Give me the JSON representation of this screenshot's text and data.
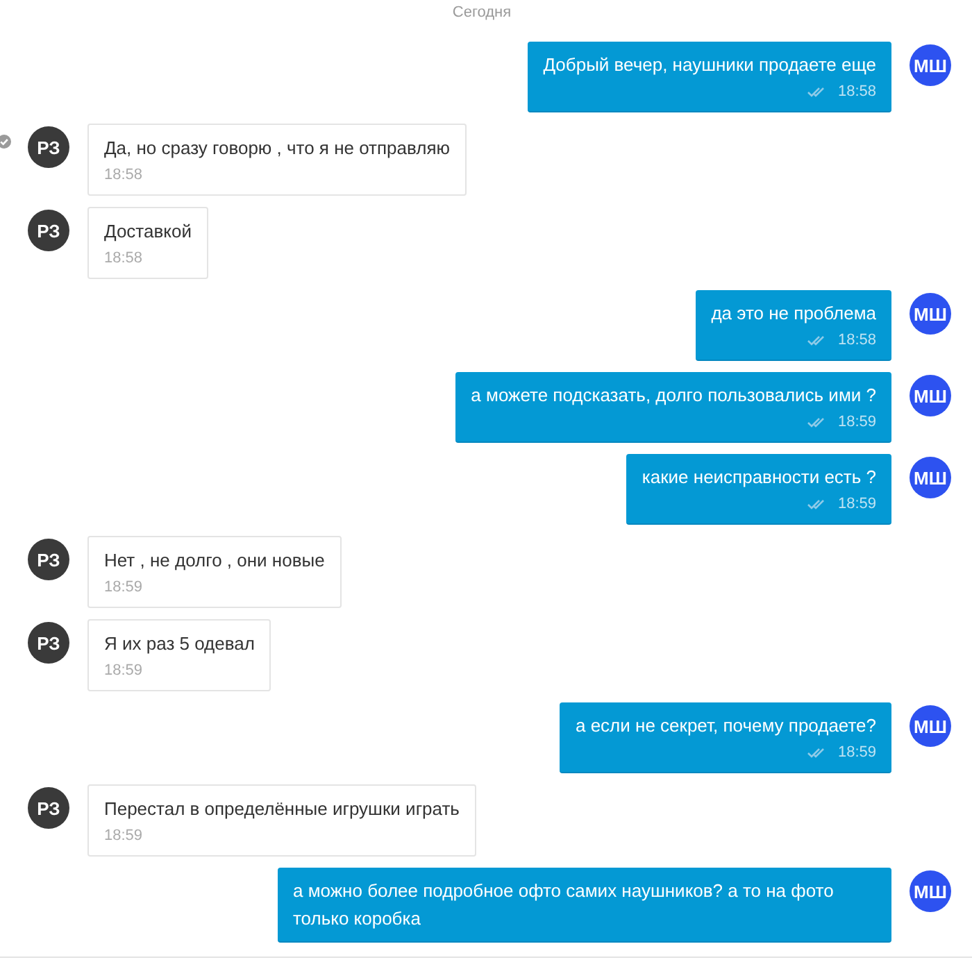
{
  "date_divider": "Сегодня",
  "messages": [
    {
      "kind": "outgoing",
      "avatar": "МШ",
      "text": "Добрый вечер, наушники продаете еще",
      "time": "18:58",
      "marked": false
    },
    {
      "kind": "incoming",
      "avatar": "РЗ",
      "text": "Да, но сразу говорю , что я не отправляю",
      "time": "18:58",
      "marked": true
    },
    {
      "kind": "incoming",
      "avatar": "РЗ",
      "text": "Доставкой",
      "time": "18:58",
      "marked": false
    },
    {
      "kind": "outgoing",
      "avatar": "МШ",
      "text": "да это не проблема",
      "time": "18:58",
      "marked": false
    },
    {
      "kind": "outgoing",
      "avatar": "МШ",
      "text": "а можете подсказать, долго пользовались ими ?",
      "time": "18:59",
      "marked": false
    },
    {
      "kind": "outgoing",
      "avatar": "МШ",
      "text": "какие неисправности есть ?",
      "time": "18:59",
      "marked": false
    },
    {
      "kind": "incoming",
      "avatar": "РЗ",
      "text": "Нет , не долго , они новые",
      "time": "18:59",
      "marked": false
    },
    {
      "kind": "incoming",
      "avatar": "РЗ",
      "text": "Я их раз 5 одевал",
      "time": "18:59",
      "marked": false
    },
    {
      "kind": "outgoing",
      "avatar": "МШ",
      "text": "а если не секрет, почему продаете?",
      "time": "18:59",
      "marked": false
    },
    {
      "kind": "incoming",
      "avatar": "РЗ",
      "text": "Перестал в определённые игрушки играть",
      "time": "18:59",
      "marked": false
    },
    {
      "kind": "outgoing",
      "avatar": "МШ",
      "text": "а можно более подробное офто самих наушников? а то на фото только коробка",
      "marked": false
    }
  ]
}
